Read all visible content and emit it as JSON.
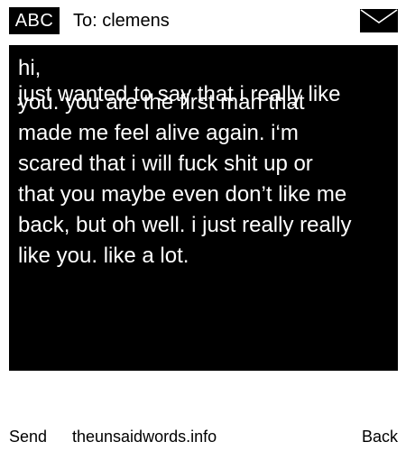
{
  "header": {
    "badge_label": "ABC",
    "recipient": "To: clemens",
    "envelope_icon": "envelope-icon"
  },
  "message": {
    "lines": [
      "hi,",
      "just wanted to say that i really like",
      "you. you are the first man that",
      "made me feel alive again. i‘m",
      "scared that i will fuck shit up or",
      "that you maybe even don’t like me",
      "back, but oh well. i just really really",
      "like you. like a lot."
    ]
  },
  "footer": {
    "send_label": "Send",
    "site_label": "theunsaidwords.info",
    "back_label": "Back"
  },
  "colors": {
    "background": "#ffffff",
    "panel": "#000000",
    "text_on_panel": "#ffffff",
    "text": "#000000"
  }
}
